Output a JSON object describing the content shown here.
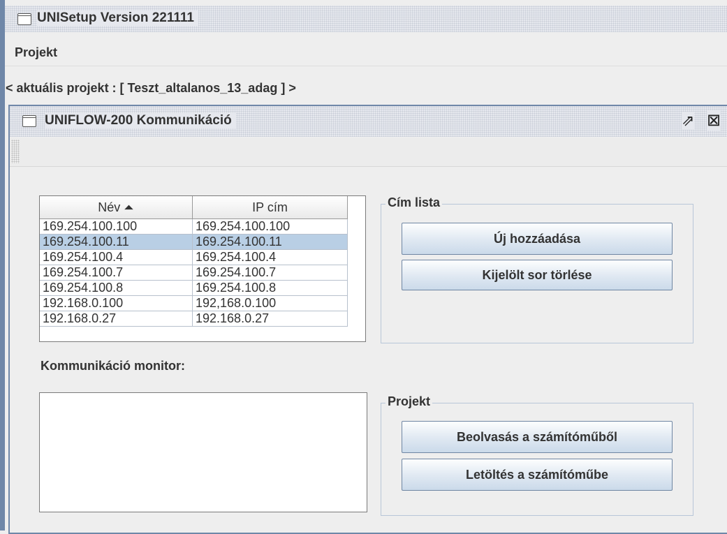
{
  "window": {
    "title": "UNISetup Version 221111",
    "menu": [
      "Projekt"
    ]
  },
  "current_project_label": "< aktuális projekt : [ Teszt_altalanos_13_adag ] >",
  "internal_frame": {
    "title": "UNIFLOW-200 Kommunikáció",
    "maximize_glyph": "⇗",
    "close_glyph": "⊠"
  },
  "table": {
    "headers": [
      "Név ⏶",
      "IP cím"
    ],
    "rows": [
      [
        "169.254.100.100",
        "169.254.100.100"
      ],
      [
        "169.254.100.11",
        "169.254.100.11"
      ],
      [
        "169.254.100.4",
        "169.254.100.4"
      ],
      [
        "169.254.100.7",
        "169.254.100.7"
      ],
      [
        "169.254.100.8",
        "169.254.100.8"
      ],
      [
        "192.168.0.100",
        "192,168.0.100"
      ],
      [
        "192.168.0.27",
        "192.168.0.27"
      ]
    ],
    "selected_row": 1
  },
  "address_list": {
    "title": "Cím lista",
    "add_button": "Új hozzáadása",
    "delete_button": "Kijelölt sor törlése"
  },
  "monitor": {
    "label": "Kommunikáció monitor:",
    "text": ""
  },
  "project": {
    "title": "Projekt",
    "read_button": "Beolvasás a számítóműből",
    "download_button": "Letöltés a számítóműbe"
  },
  "icons": {
    "scroll_up": "▲",
    "scroll_down": "▼"
  },
  "colors": {
    "selection": "#b9cfe5",
    "frame_border": "#6f87a8"
  }
}
